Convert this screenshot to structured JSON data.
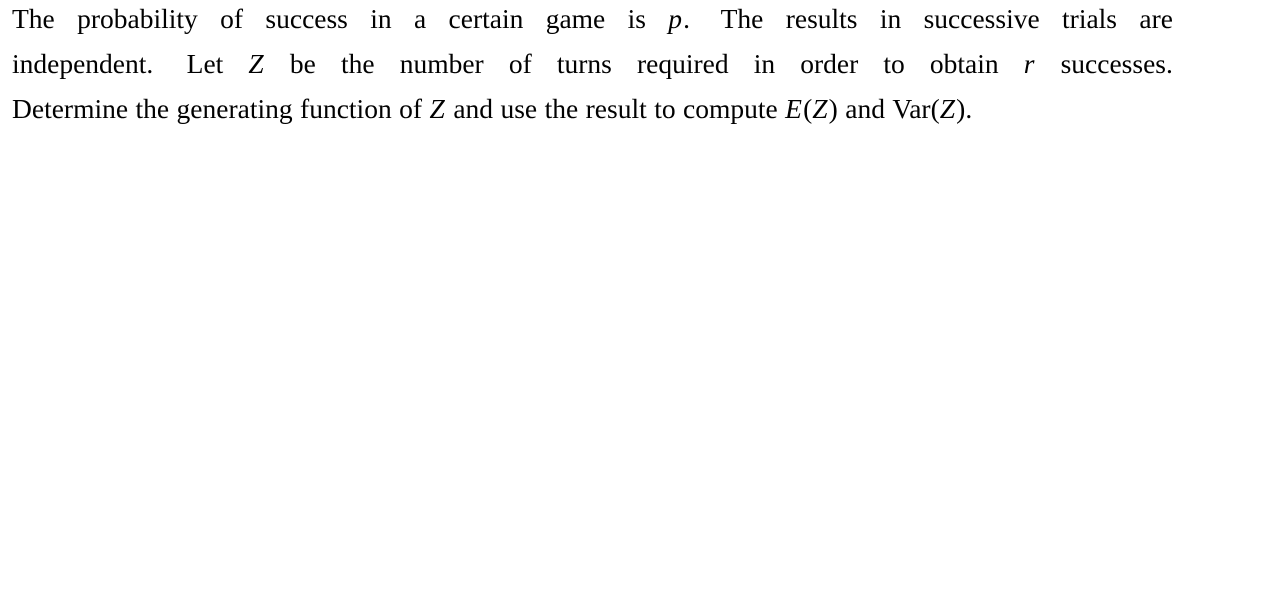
{
  "document": {
    "type": "latex-problem-statement",
    "background_color": "#ffffff",
    "text_color": "#010101",
    "full_text": "The probability of success in a certain game is p. The results in successive trials are independent. Let Z be the number of turns required in order to obtain r successes. Determine the generating function of Z and use the result to compute E(Z) and Var(Z).",
    "math_symbols": [
      "p",
      "Z",
      "r",
      "E(Z)",
      "Var(Z)"
    ],
    "lines": [
      {
        "index": 1,
        "justified": true,
        "tokens": [
          {
            "text": "The",
            "style": "roman"
          },
          {
            "text": "probability",
            "style": "roman"
          },
          {
            "text": "of",
            "style": "roman"
          },
          {
            "text": "success",
            "style": "roman"
          },
          {
            "text": "in",
            "style": "roman"
          },
          {
            "text": "a",
            "style": "roman"
          },
          {
            "text": "certain",
            "style": "roman"
          },
          {
            "text": "game",
            "style": "roman"
          },
          {
            "text": "is",
            "style": "roman"
          },
          {
            "text": "p",
            "style": "math",
            "trailing": "."
          },
          {
            "text": "The",
            "style": "roman"
          },
          {
            "text": "results",
            "style": "roman"
          },
          {
            "text": "in",
            "style": "roman"
          },
          {
            "text": "successive",
            "style": "roman"
          },
          {
            "text": "trials",
            "style": "roman"
          },
          {
            "text": "are",
            "style": "roman"
          }
        ]
      },
      {
        "index": 2,
        "justified": true,
        "tokens": [
          {
            "text": "independent",
            "style": "roman",
            "trailing": "."
          },
          {
            "text": "Let",
            "style": "roman"
          },
          {
            "text": "Z",
            "style": "math"
          },
          {
            "text": "be",
            "style": "roman"
          },
          {
            "text": "the",
            "style": "roman"
          },
          {
            "text": "number",
            "style": "roman"
          },
          {
            "text": "of",
            "style": "roman"
          },
          {
            "text": "turns",
            "style": "roman"
          },
          {
            "text": "required",
            "style": "roman"
          },
          {
            "text": "in",
            "style": "roman"
          },
          {
            "text": "order",
            "style": "roman"
          },
          {
            "text": "to",
            "style": "roman"
          },
          {
            "text": "obtain",
            "style": "roman"
          },
          {
            "text": "r",
            "style": "math"
          },
          {
            "text": "successes",
            "style": "roman",
            "trailing": "."
          }
        ]
      },
      {
        "index": 3,
        "justified": false,
        "tokens": [
          {
            "text": "Determine",
            "style": "roman"
          },
          {
            "text": "the",
            "style": "roman"
          },
          {
            "text": "generating",
            "style": "roman"
          },
          {
            "text": "function",
            "style": "roman"
          },
          {
            "text": "of",
            "style": "roman"
          },
          {
            "text": "Z",
            "style": "math"
          },
          {
            "text": "and",
            "style": "roman"
          },
          {
            "text": "use",
            "style": "roman"
          },
          {
            "text": "the",
            "style": "roman"
          },
          {
            "text": "result",
            "style": "roman"
          },
          {
            "text": "to",
            "style": "roman"
          },
          {
            "text": "compute",
            "style": "roman"
          },
          {
            "text": "E(Z)",
            "style": "math-expr"
          },
          {
            "text": "and",
            "style": "roman"
          },
          {
            "text": "Var(Z)",
            "style": "math-expr",
            "trailing": "."
          }
        ]
      }
    ],
    "line1": {
      "t1": "The",
      "t2": "probability",
      "t3": "of",
      "t4": "success",
      "t5": "in",
      "t6": "a",
      "t7": "certain",
      "t8": "game",
      "t9": "is",
      "t10_math": "p",
      "t10_punct": ".",
      "t11": "The",
      "t12": "results",
      "t13": "in",
      "t14": "successive",
      "t15": "trials",
      "t16": "are"
    },
    "line2": {
      "t1": "independent.",
      "t2": "Let",
      "t3_math": "Z",
      "t4": "be",
      "t5": "the",
      "t6": "number",
      "t7": "of",
      "t8": "turns",
      "t9": "required",
      "t10": "in",
      "t11": "order",
      "t12": "to",
      "t13": "obtain",
      "t14_math": "r",
      "t15": "successes."
    },
    "line3": {
      "t1": "Determine",
      "t2": "the",
      "t3": "generating",
      "t4": "function",
      "t5": "of",
      "t6_math": "Z",
      "t7": "and",
      "t8": "use",
      "t9": "the",
      "t10": "result",
      "t11": "to",
      "t12": "compute",
      "t13_var": "E",
      "t13_open": "(",
      "t13_arg": "Z",
      "t13_close": ")",
      "t14": "and",
      "t15_op": "Var",
      "t15_open": "(",
      "t15_arg": "Z",
      "t15_close": ")",
      "t15_punct": "."
    }
  }
}
